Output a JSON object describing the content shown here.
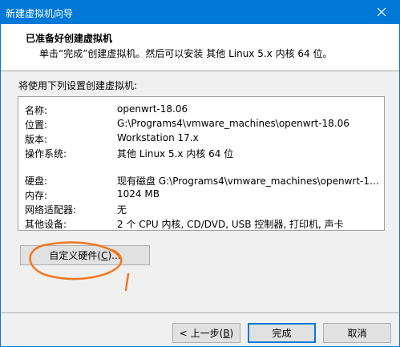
{
  "window": {
    "title": "新建虚拟机向导"
  },
  "header": {
    "title": "已准备好创建虚拟机",
    "subtitle": "单击“完成”创建虚拟机。然后可以安装 其他 Linux 5.x 内核 64 位。"
  },
  "intro": "将使用下列设置创建虚拟机:",
  "summary": [
    {
      "key": "名称:",
      "value": "openwrt-18.06"
    },
    {
      "key": "位置:",
      "value": "G:\\Programs4\\vmware_machines\\openwrt-18.06"
    },
    {
      "key": "版本:",
      "value": "Workstation 17.x"
    },
    {
      "key": "操作系统:",
      "value": "其他 Linux 5.x 内核 64 位"
    },
    {
      "key": "硬盘:",
      "value": "现有磁盘 G:\\Programs4\\vmware_machines\\openwrt-18.06..."
    },
    {
      "key": "内存:",
      "value": "1024 MB"
    },
    {
      "key": "网络适配器:",
      "value": "无"
    },
    {
      "key": "其他设备:",
      "value": "2 个 CPU 内核, CD/DVD, USB 控制器, 打印机, 声卡"
    }
  ],
  "buttons": {
    "customize": {
      "text": "自定义硬件(",
      "mnemonic": "C",
      "suffix": ")..."
    },
    "back": {
      "text": "< 上一步(",
      "mnemonic": "B",
      "suffix": ")"
    },
    "finish": "完成",
    "cancel": "取消"
  },
  "colors": {
    "titlebar": "#0078d7",
    "annotation": "#f07820"
  }
}
